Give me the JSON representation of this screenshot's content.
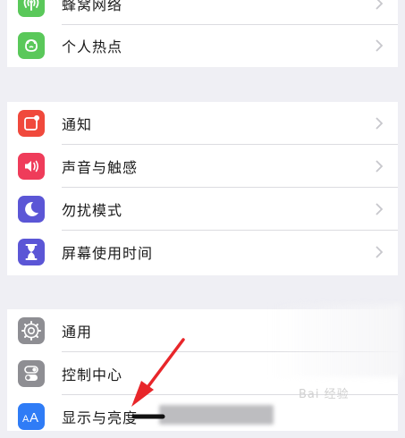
{
  "settings": {
    "group1": [
      {
        "label": "蜂窝网络",
        "icon": "antenna-icon",
        "color": "#5ac85a"
      },
      {
        "label": "个人热点",
        "icon": "hotspot-icon",
        "color": "#5ac85a"
      }
    ],
    "group2": [
      {
        "label": "通知",
        "icon": "notification-icon",
        "color": "#f0493c"
      },
      {
        "label": "声音与触感",
        "icon": "speaker-icon",
        "color": "#ef3c5a"
      },
      {
        "label": "勿扰模式",
        "icon": "moon-icon",
        "color": "#5b56d6"
      },
      {
        "label": "屏幕使用时间",
        "icon": "hourglass-icon",
        "color": "#5b56d6"
      }
    ],
    "group3": [
      {
        "label": "通用",
        "icon": "gear-icon",
        "color": "#8e8e93"
      },
      {
        "label": "控制中心",
        "icon": "toggle-icon",
        "color": "#8e8e93"
      },
      {
        "label": "显示与亮度",
        "icon": "text-size-icon",
        "color": "#2f7cf6"
      }
    ]
  },
  "watermark": "Bai 经验",
  "colors": {
    "background": "#efeff4",
    "cell": "#ffffff",
    "separator": "#dcdce0",
    "chevron": "#c7c7cc",
    "annotation_arrow": "#e8262a"
  }
}
